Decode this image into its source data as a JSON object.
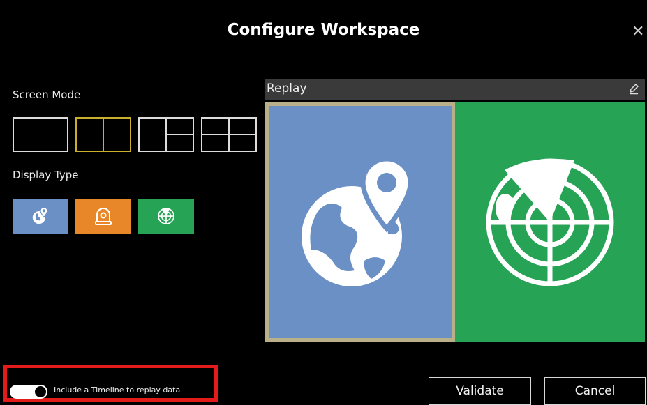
{
  "dialog": {
    "title": "Configure Workspace",
    "close_icon": "close-icon"
  },
  "screen_mode": {
    "label": "Screen Mode",
    "options": [
      "single",
      "split-vertical-2",
      "split-1-plus-2",
      "grid-2x2"
    ],
    "selected": "split-vertical-2",
    "selected_color": "#c9b02b"
  },
  "display_type": {
    "label": "Display Type",
    "options": [
      {
        "name": "map",
        "icon": "globe-pin-icon",
        "color": "#6a90c6"
      },
      {
        "name": "camera",
        "icon": "dome-camera-icon",
        "color": "#e8872a"
      },
      {
        "name": "radar",
        "icon": "radar-icon",
        "color": "#27a356"
      }
    ]
  },
  "preview": {
    "title": "Replay",
    "edit_icon": "pencil-icon",
    "panes": [
      {
        "type": "map",
        "icon": "globe-pin-icon",
        "color": "#6a90c6"
      },
      {
        "type": "radar",
        "icon": "radar-icon",
        "color": "#27a356"
      }
    ]
  },
  "timeline": {
    "label": "Include a Timeline to replay data",
    "enabled": true,
    "highlight_color": "#e31b1b"
  },
  "buttons": {
    "validate": "Validate",
    "cancel": "Cancel"
  }
}
